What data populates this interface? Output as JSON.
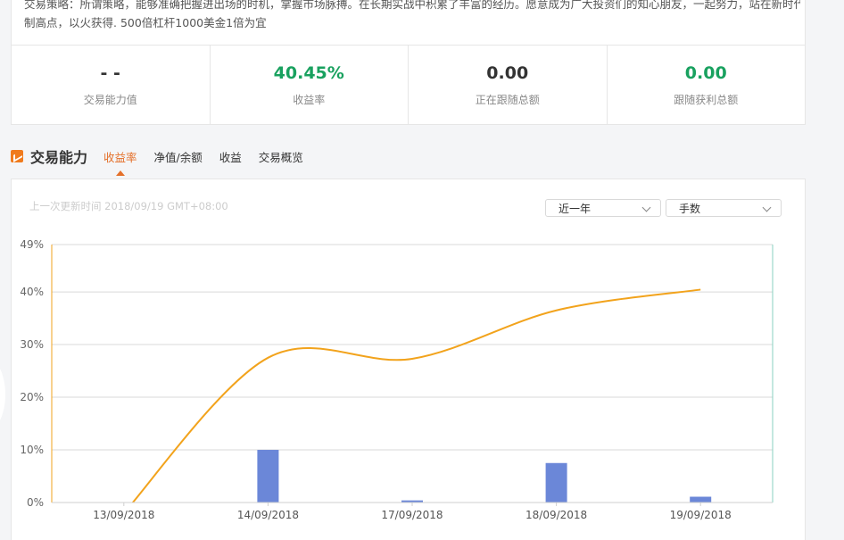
{
  "profile": {
    "strategy_line1": "交易策略：所谓策略，能够准确把握进出场的时机，掌握市场脉搏。在长期实战中积累了丰富的经历。愿意成为广大投资们的知心朋友，一起努力，站在新时代的",
    "strategy_line2": "制高点，以火获得. 500倍杠杆1000美金1倍为宜"
  },
  "stats": [
    {
      "value": "- -",
      "label": "交易能力值"
    },
    {
      "value": "40.45%",
      "label": "收益率",
      "color": "#19a15f"
    },
    {
      "value": "0.00",
      "label": "正在跟随总额"
    },
    {
      "value": "0.00",
      "label": "跟随获利总额",
      "color": "#19a15f"
    }
  ],
  "section": {
    "title": "交易能力",
    "icon": "chart-icon",
    "tabs": [
      "收益率",
      "净值/余额",
      "收益",
      "交易概览"
    ],
    "active_tab": "收益率"
  },
  "chart_panel": {
    "updated_text": "上一次更新时间 2018/09/19 GMT+08:00",
    "period_select": "近一年",
    "unit_select": "手数"
  },
  "colors": {
    "accent": "#e4702a",
    "green": "#19a15f",
    "line": "#f2a31c",
    "bar": "#6b87d8"
  },
  "chart_data": {
    "type": "line",
    "categories": [
      "13/09/2018",
      "14/09/2018",
      "17/09/2018",
      "18/09/2018",
      "19/09/2018"
    ],
    "ylim": [
      0,
      49
    ],
    "y_ticks": [
      "0%",
      "10%",
      "20%",
      "30%",
      "40%",
      "49%"
    ],
    "y_tick_values": [
      0,
      10,
      20,
      30,
      40,
      49
    ],
    "series": [
      {
        "type": "line",
        "values": [
          -2,
          27.5,
          27.3,
          36.5,
          40.45
        ]
      },
      {
        "type": "bar",
        "values": [
          0,
          10,
          0.4,
          7.5,
          1.1
        ]
      }
    ],
    "grid": true
  }
}
